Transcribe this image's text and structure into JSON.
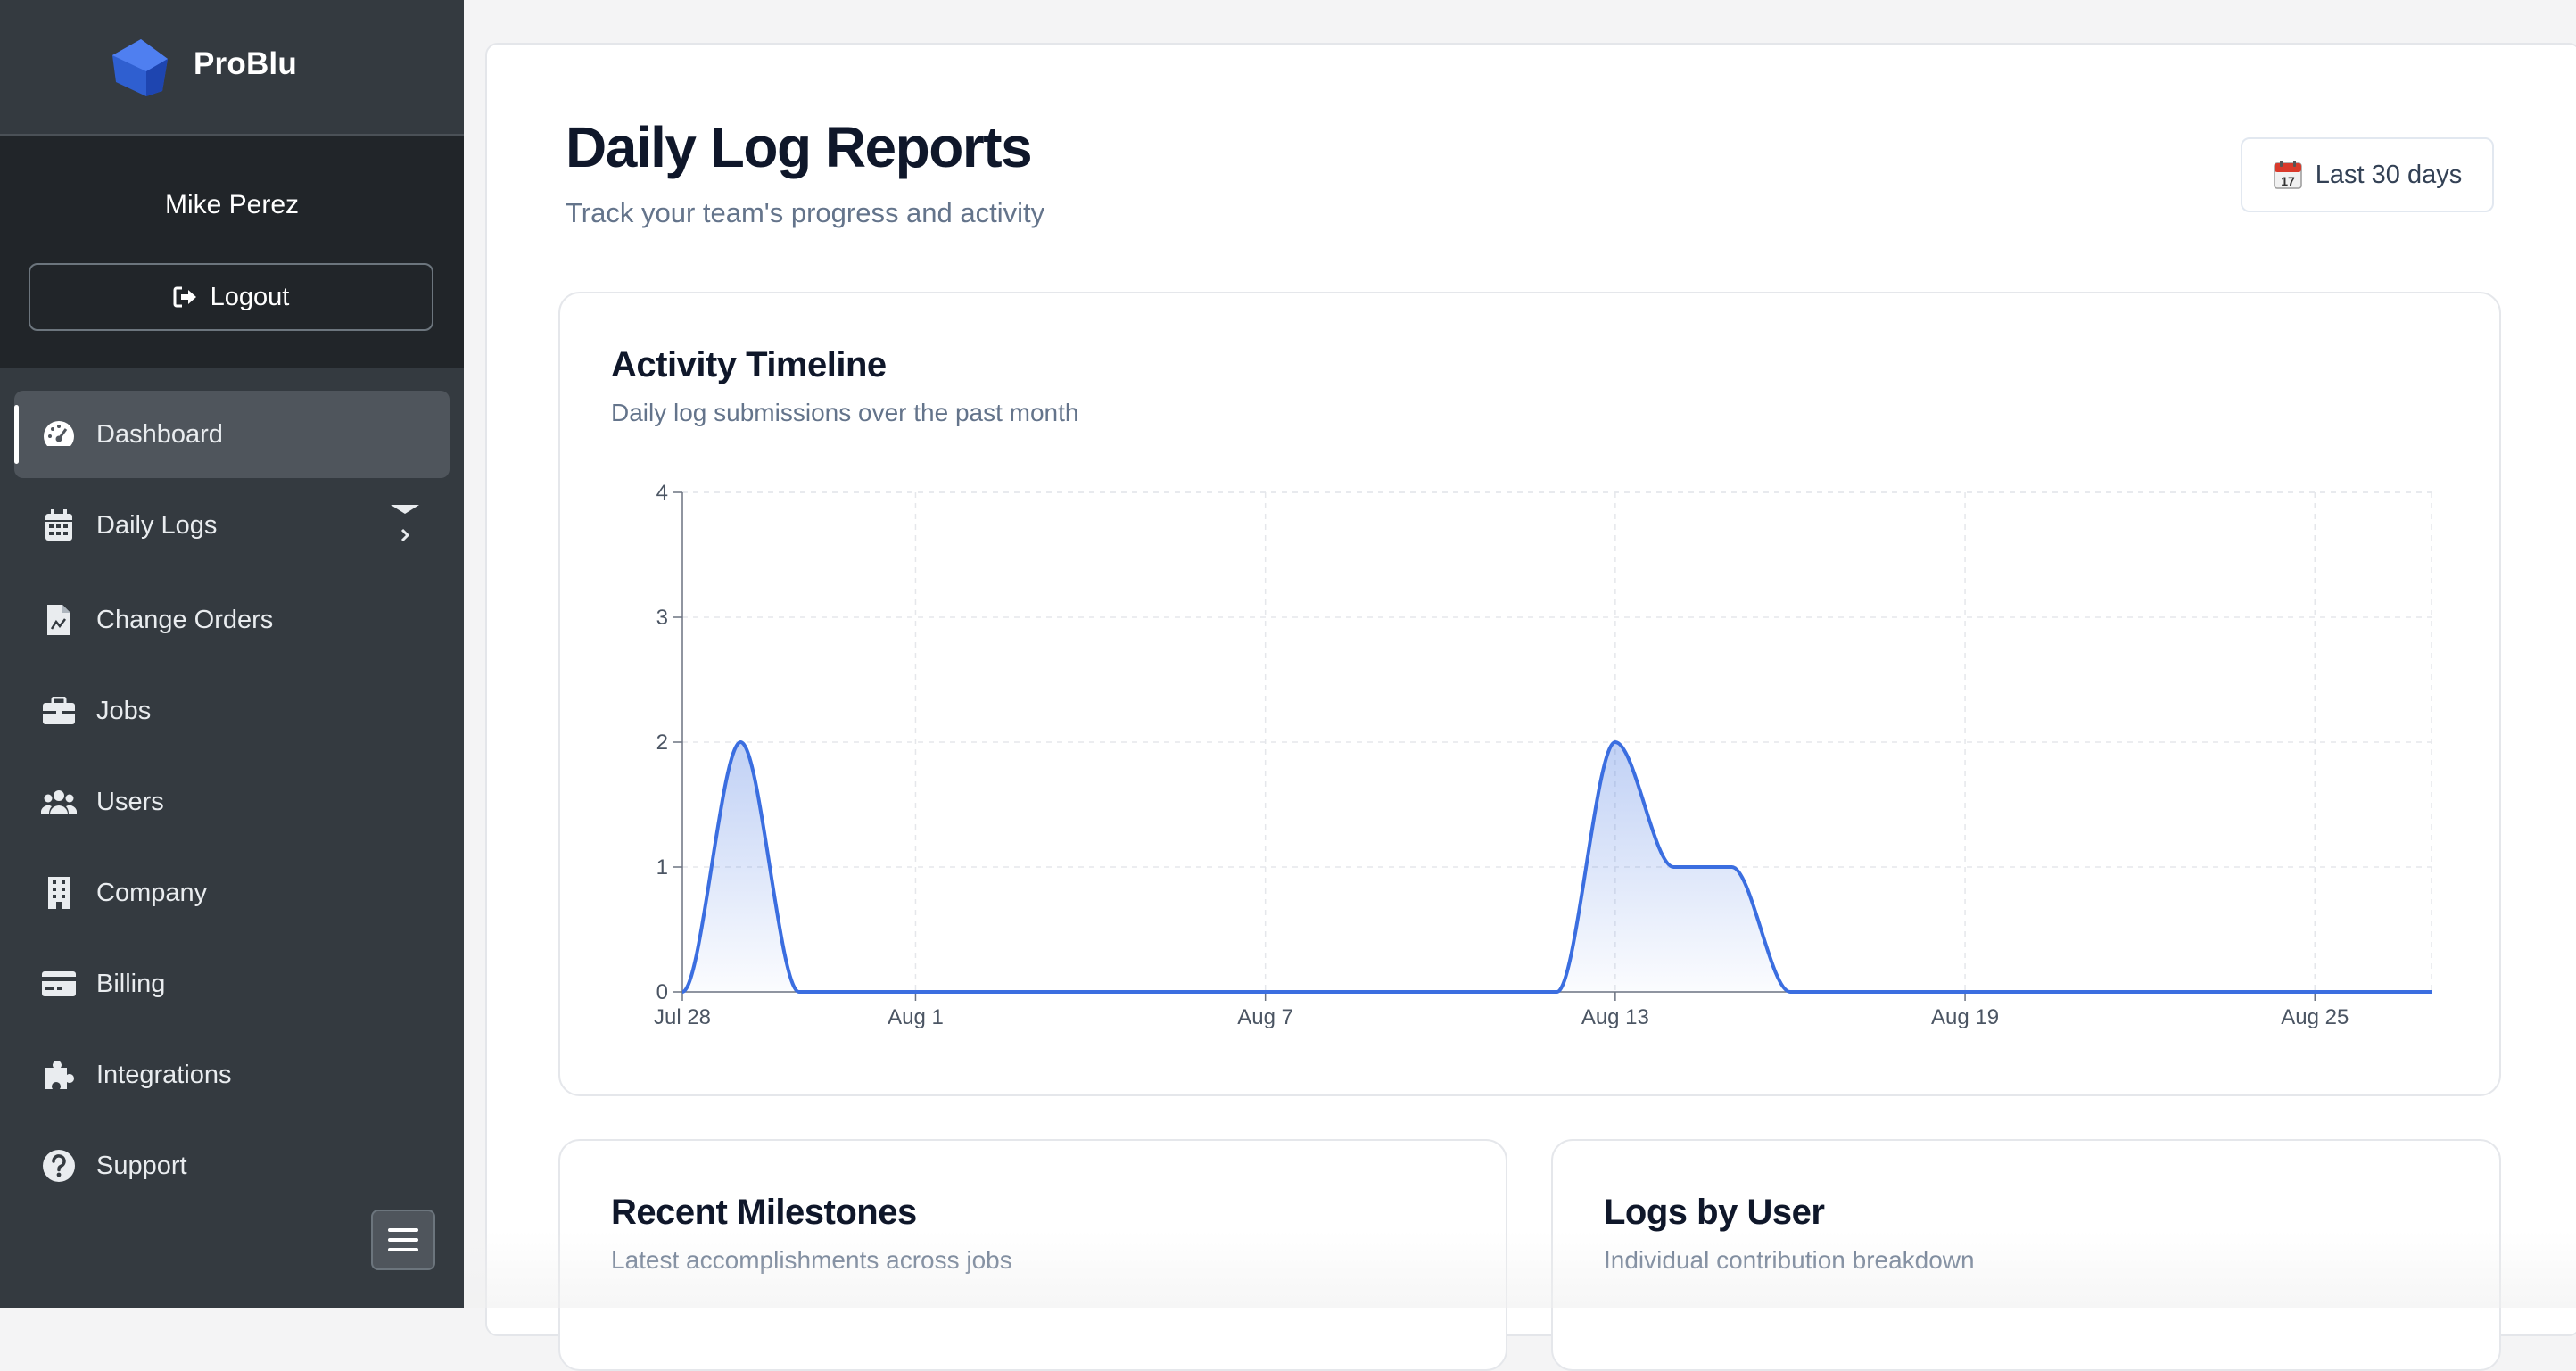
{
  "brand": {
    "name": "ProBlu",
    "logo_icon": "house-logo-icon",
    "accent": "#2f5fd0"
  },
  "user": {
    "name": "Mike Perez",
    "logout_label": "Logout"
  },
  "nav": {
    "items": [
      {
        "label": "Dashboard",
        "icon": "dashboard-gauge-icon",
        "active": true
      },
      {
        "label": "Daily Logs",
        "icon": "calendar-icon",
        "has_submenu": true
      },
      {
        "label": "Change Orders",
        "icon": "file-invoice-icon"
      },
      {
        "label": "Jobs",
        "icon": "briefcase-icon"
      },
      {
        "label": "Users",
        "icon": "users-icon"
      },
      {
        "label": "Company",
        "icon": "building-icon"
      },
      {
        "label": "Billing",
        "icon": "credit-card-icon"
      },
      {
        "label": "Integrations",
        "icon": "puzzle-icon"
      },
      {
        "label": "Support",
        "icon": "question-circle-icon"
      }
    ],
    "menu_toggle_icon": "hamburger-icon"
  },
  "header": {
    "title": "Daily Log Reports",
    "subtitle": "Track your team's progress and activity",
    "range_label": "Last 30 days",
    "range_icon": "calendar-emoji-icon"
  },
  "activity": {
    "title": "Activity Timeline",
    "subtitle": "Daily log submissions over the past month"
  },
  "milestones": {
    "title": "Recent Milestones",
    "subtitle": "Latest accomplishments across jobs"
  },
  "logs_by_user": {
    "title": "Logs by User",
    "subtitle": "Individual contribution breakdown"
  },
  "chart_data": {
    "type": "area",
    "x": [
      "Jul 28",
      "Jul 29",
      "Jul 30",
      "Jul 31",
      "Aug 1",
      "Aug 2",
      "Aug 3",
      "Aug 4",
      "Aug 5",
      "Aug 6",
      "Aug 7",
      "Aug 8",
      "Aug 9",
      "Aug 10",
      "Aug 11",
      "Aug 12",
      "Aug 13",
      "Aug 14",
      "Aug 15",
      "Aug 16",
      "Aug 17",
      "Aug 18",
      "Aug 19",
      "Aug 20",
      "Aug 21",
      "Aug 22",
      "Aug 23",
      "Aug 24",
      "Aug 25",
      "Aug 26",
      "Aug 27"
    ],
    "series": [
      {
        "values": [
          0,
          2,
          0,
          0,
          0,
          0,
          0,
          0,
          0,
          0,
          0,
          0,
          0,
          0,
          0,
          0,
          2,
          1,
          1,
          0,
          0,
          0,
          0,
          0,
          0,
          0,
          0,
          0,
          0,
          0,
          0
        ]
      }
    ],
    "x_ticks": [
      "Jul 28",
      "Aug 1",
      "Aug 7",
      "Aug 13",
      "Aug 19",
      "Aug 25"
    ],
    "y_ticks": [
      0,
      1,
      2,
      3,
      4
    ],
    "ylim": [
      0,
      4
    ],
    "grid": true,
    "line_color": "#3b6ee0"
  }
}
